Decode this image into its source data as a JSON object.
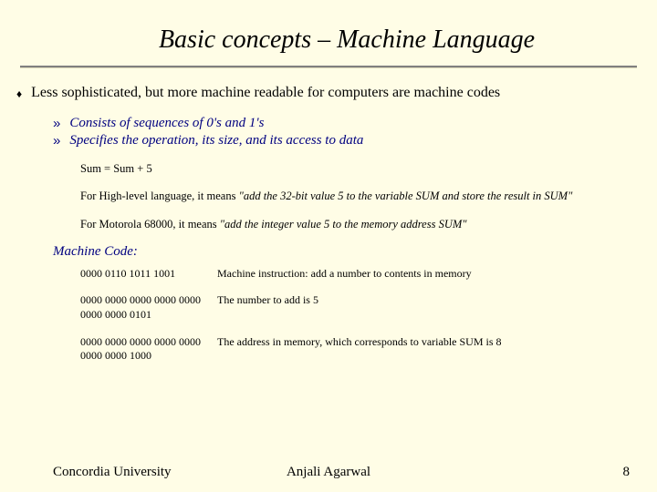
{
  "title": "Basic concepts – Machine Language",
  "main_bullet": "Less sophisticated, but more machine readable for computers are machine codes",
  "sub_bullets": [
    "Consists of sequences of 0's and 1's",
    "Specifies the operation, its size, and its access to data"
  ],
  "example_line1": "Sum = Sum + 5",
  "example_line2_prefix": "For High-level language, it means ",
  "example_line2_italic": "\"add the 32-bit value 5 to the variable SUM and store the result in SUM\"",
  "example_line3_prefix": "For Motorola 68000, it means ",
  "example_line3_italic": "\"add the integer value 5 to the memory address SUM\"",
  "machine_code_header": "Machine Code:",
  "mc_rows": [
    {
      "bits": "0000 0110 1011 1001",
      "desc": "Machine instruction: add a number to contents in memory"
    },
    {
      "bits": "0000 0000 0000 0000 0000 0000 0000 0101",
      "desc": "The number to add is 5"
    },
    {
      "bits": "0000 0000 0000 0000 0000 0000 0000 1000",
      "desc": "The address in memory, which corresponds to variable SUM is 8"
    }
  ],
  "footer": {
    "left": "Concordia University",
    "center": "Anjali Agarwal",
    "right": "8"
  }
}
